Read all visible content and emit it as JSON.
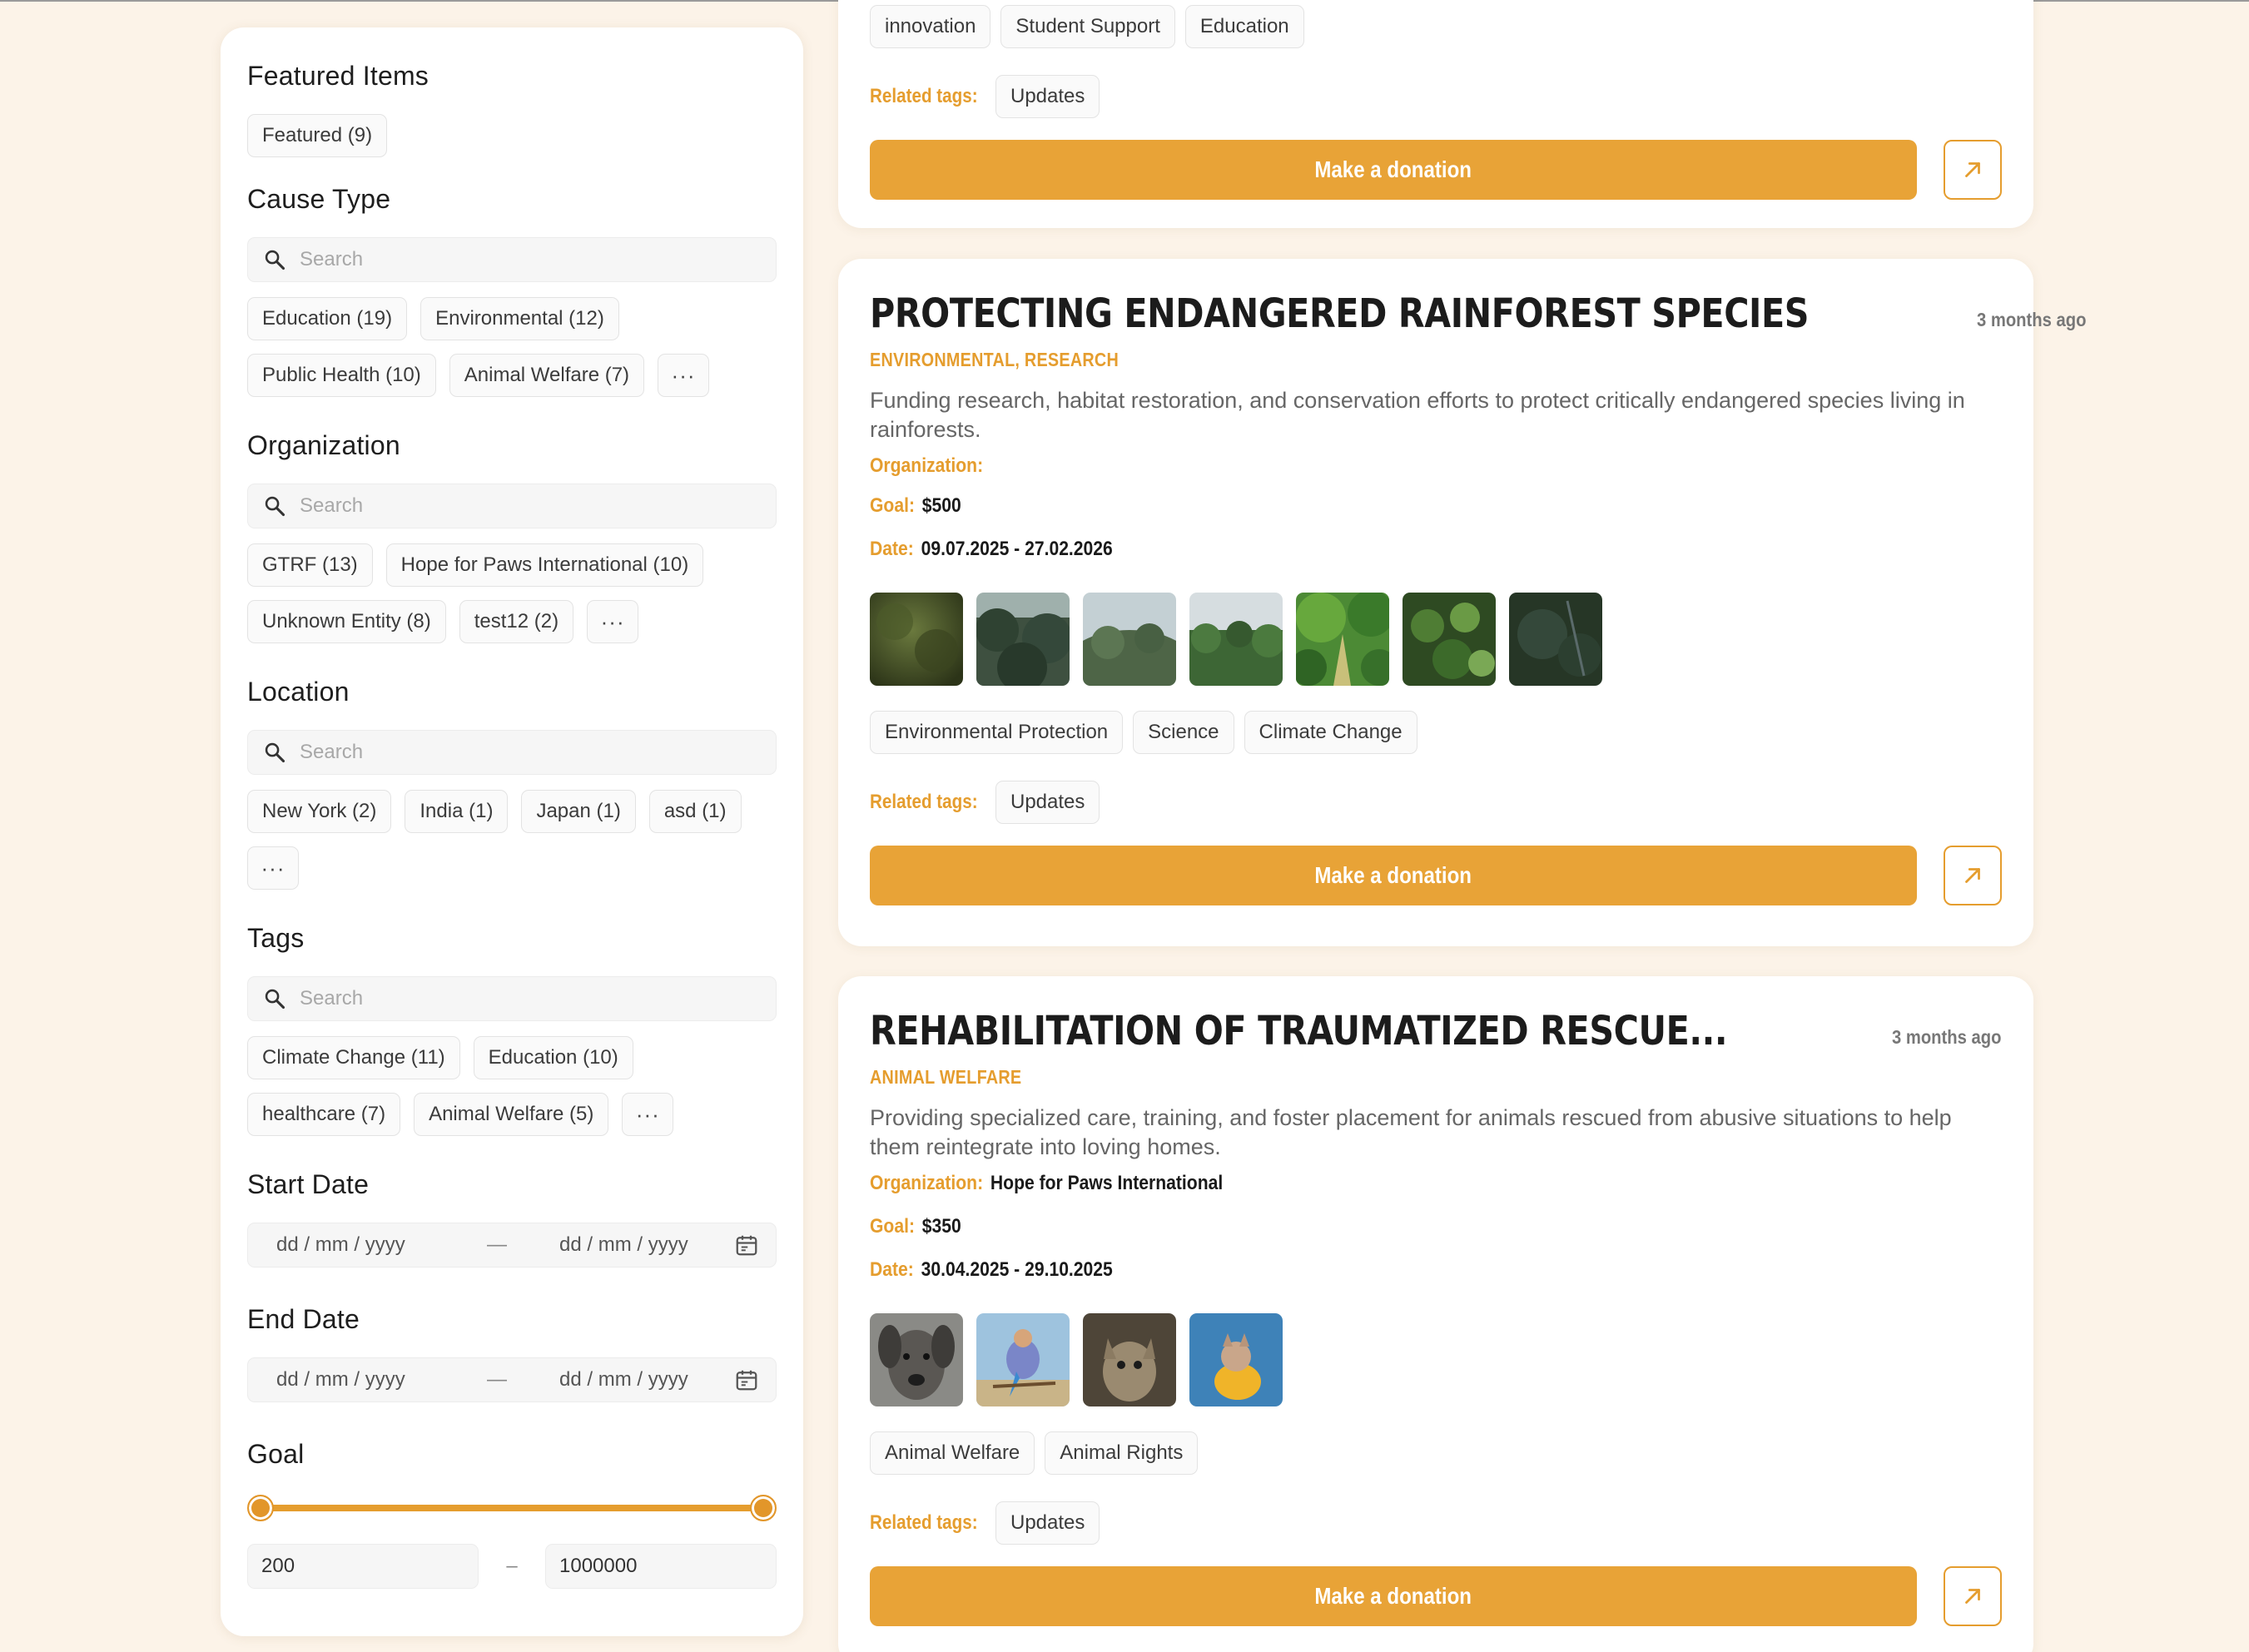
{
  "sidebar": {
    "featured": {
      "title": "Featured Items",
      "chips": [
        "Featured (9)"
      ]
    },
    "cause_type": {
      "title": "Cause Type",
      "search_placeholder": "Search",
      "chips": [
        "Education (19)",
        "Environmental (12)",
        "Public Health (10)",
        "Animal Welfare (7)"
      ],
      "more": "···"
    },
    "organization": {
      "title": "Organization",
      "search_placeholder": "Search",
      "chips": [
        "GTRF (13)",
        "Hope for Paws International (10)",
        "Unknown Entity (8)",
        "test12 (2)"
      ],
      "more": "···"
    },
    "location": {
      "title": "Location",
      "search_placeholder": "Search",
      "chips": [
        "New York (2)",
        "India (1)",
        "Japan (1)",
        "asd (1)"
      ],
      "more": "···"
    },
    "tags": {
      "title": "Tags",
      "search_placeholder": "Search",
      "chips": [
        "Climate Change (11)",
        "Education (10)",
        "healthcare (7)",
        "Animal Welfare (5)"
      ],
      "more": "···"
    },
    "start_date": {
      "title": "Start Date",
      "from": "dd / mm / yyyy",
      "sep": "—",
      "to": "dd / mm / yyyy"
    },
    "end_date": {
      "title": "End Date",
      "from": "dd / mm / yyyy",
      "sep": "—",
      "to": "dd / mm / yyyy"
    },
    "goal": {
      "title": "Goal",
      "min": "200",
      "sep": "–",
      "max": "1000000",
      "slider_min_fraction": 0.0,
      "slider_max_fraction": 1.0
    }
  },
  "cards": [
    {
      "tags": [
        "innovation",
        "Student Support",
        "Education"
      ],
      "related_label": "Related tags:",
      "related": [
        "Updates"
      ],
      "donate_label": "Make a donation"
    },
    {
      "title": "PROTECTING ENDANGERED RAINFOREST SPECIES",
      "time": "3 months ago",
      "categories": "ENVIRONMENTAL, RESEARCH",
      "description": "Funding research, habitat restoration, and conservation efforts to protect critically endangered species living in rainforests.",
      "org_label": "Organization:",
      "org_value": "",
      "goal_label": "Goal:",
      "goal_value": "$500",
      "date_label": "Date:",
      "date_value": "09.07.2025 - 27.02.2026",
      "tags": [
        "Environmental Protection",
        "Science",
        "Climate Change"
      ],
      "related_label": "Related tags:",
      "related": [
        "Updates"
      ],
      "donate_label": "Make a donation"
    },
    {
      "title": "REHABILITATION OF TRAUMATIZED RESCUE...",
      "time": "3 months ago",
      "categories": "ANIMAL WELFARE",
      "description": "Providing specialized care, training, and foster placement for animals rescued from abusive situations to help them reintegrate into loving homes.",
      "org_label": "Organization:",
      "org_value": "Hope for Paws International",
      "goal_label": "Goal:",
      "goal_value": "$350",
      "date_label": "Date:",
      "date_value": "30.04.2025 - 29.10.2025",
      "tags": [
        "Animal Welfare",
        "Animal Rights"
      ],
      "related_label": "Related tags:",
      "related": [
        "Updates"
      ],
      "donate_label": "Make a donation"
    }
  ],
  "colors": {
    "accent": "#e59d2e",
    "button": "#e8a337",
    "background": "#fcf3e8"
  }
}
